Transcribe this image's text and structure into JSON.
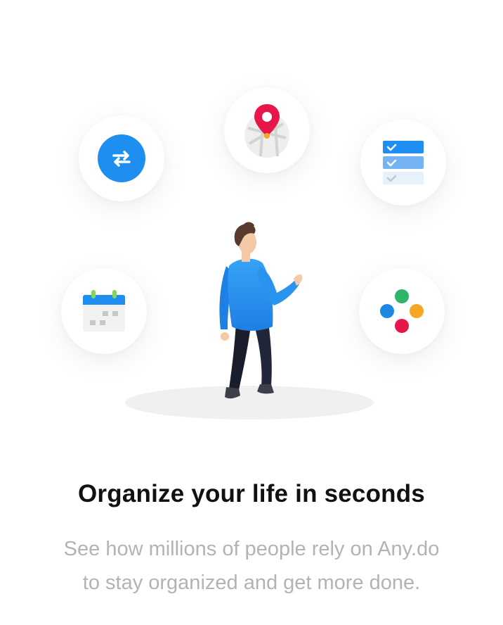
{
  "onboarding": {
    "title": "Organize your life in seconds",
    "subtitle_line1": "See how millions of people rely on Any.do",
    "subtitle_line2": "to stay organized and get more done."
  },
  "icons": {
    "sync": "sync-arrows-icon",
    "map": "location-pin-map-icon",
    "tasks": "checklist-icon",
    "calendar": "calendar-icon",
    "integrations": "colored-dots-icon",
    "person": "person-illustration"
  },
  "colors": {
    "brand_blue": "#1f8ef1",
    "pin_red": "#e8174a",
    "dot_green": "#2db56b",
    "dot_orange": "#f5a623",
    "dot_blue": "#1e88e5",
    "dot_red": "#e8174a",
    "title": "#111111",
    "subtitle": "#b3b3b3"
  }
}
